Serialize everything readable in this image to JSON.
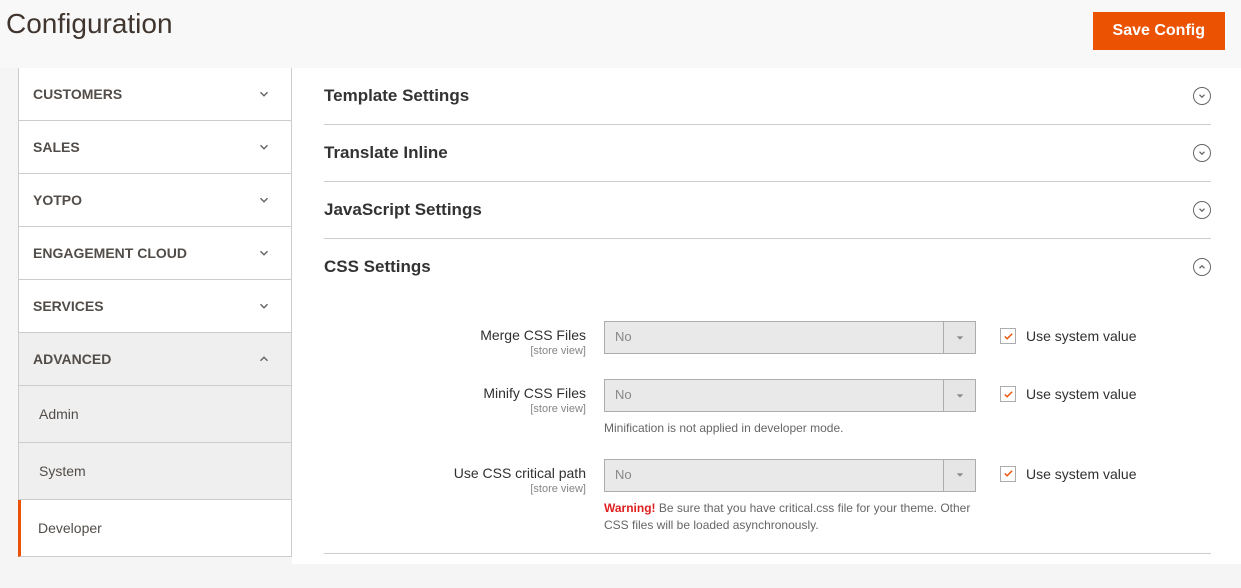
{
  "page_title": "Configuration",
  "save_button": "Save Config",
  "sidebar": {
    "categories": [
      {
        "label": "CUSTOMERS",
        "expanded": false
      },
      {
        "label": "SALES",
        "expanded": false
      },
      {
        "label": "YOTPO",
        "expanded": false
      },
      {
        "label": "ENGAGEMENT CLOUD",
        "expanded": false
      },
      {
        "label": "SERVICES",
        "expanded": false
      },
      {
        "label": "ADVANCED",
        "expanded": true
      }
    ],
    "advanced_items": [
      {
        "label": "Admin",
        "selected": false
      },
      {
        "label": "System",
        "selected": false
      },
      {
        "label": "Developer",
        "selected": true
      }
    ]
  },
  "sections": {
    "template": "Template Settings",
    "translate": "Translate Inline",
    "javascript": "JavaScript Settings",
    "css": "CSS Settings"
  },
  "css_settings": {
    "merge": {
      "label": "Merge CSS Files",
      "scope": "[store view]",
      "value": "No",
      "use_system": true,
      "use_system_label": "Use system value"
    },
    "minify": {
      "label": "Minify CSS Files",
      "scope": "[store view]",
      "value": "No",
      "note": "Minification is not applied in developer mode.",
      "use_system": true,
      "use_system_label": "Use system value"
    },
    "critical": {
      "label": "Use CSS critical path",
      "scope": "[store view]",
      "value": "No",
      "warning_label": "Warning!",
      "warning_text": " Be sure that you have critical.css file for your theme. Other CSS files will be loaded asynchronously.",
      "use_system": true,
      "use_system_label": "Use system value"
    }
  }
}
